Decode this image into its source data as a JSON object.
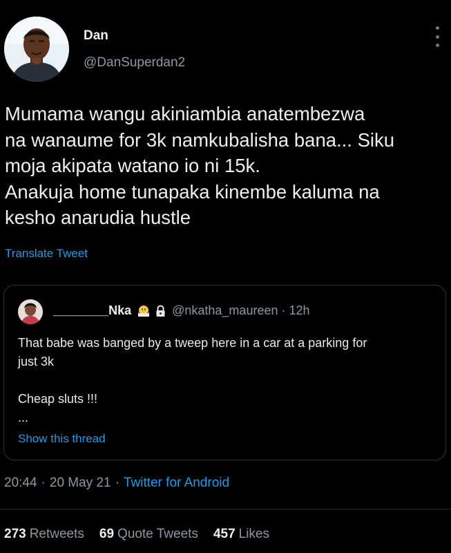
{
  "author": {
    "display_name": "Dan",
    "handle": "@DanSuperdan2",
    "avatar": "profile-photo-avatar",
    "more_icon": "more-vertical-icon"
  },
  "tweet": {
    "text": "Mumama wangu akiniambia anatembezwa\nna wanaume for 3k namkubalisha bana... Siku\nmoja akipata watano io ni 15k.\nAnakuja home tunapaka kinembe kaluma na\nkesho anarudia hustle",
    "translate_label": "Translate Tweet"
  },
  "quoted": {
    "display_name": "________Nka",
    "emoji_icon": "hatching-chick-icon",
    "lock_icon": "lock-icon",
    "handle": "@nkatha_maureen",
    "separator": "·",
    "time": "12h",
    "body": "That babe was banged by a tweep here in a car at a parking for\njust 3k\n\nCheap sluts !!!\n...",
    "show_thread_label": "Show this thread"
  },
  "meta": {
    "time": "20:44",
    "separator": "·",
    "date": "20 May 21",
    "source": "Twitter for Android"
  },
  "stats": {
    "retweets_count": "273",
    "retweets_label": "Retweets",
    "quote_count": "69",
    "quote_label": "Quote Tweets",
    "likes_count": "457",
    "likes_label": "Likes"
  },
  "colors": {
    "background": "#000000",
    "link": "#1d9bf0",
    "muted": "#8b98a5",
    "border": "#2f3336"
  }
}
